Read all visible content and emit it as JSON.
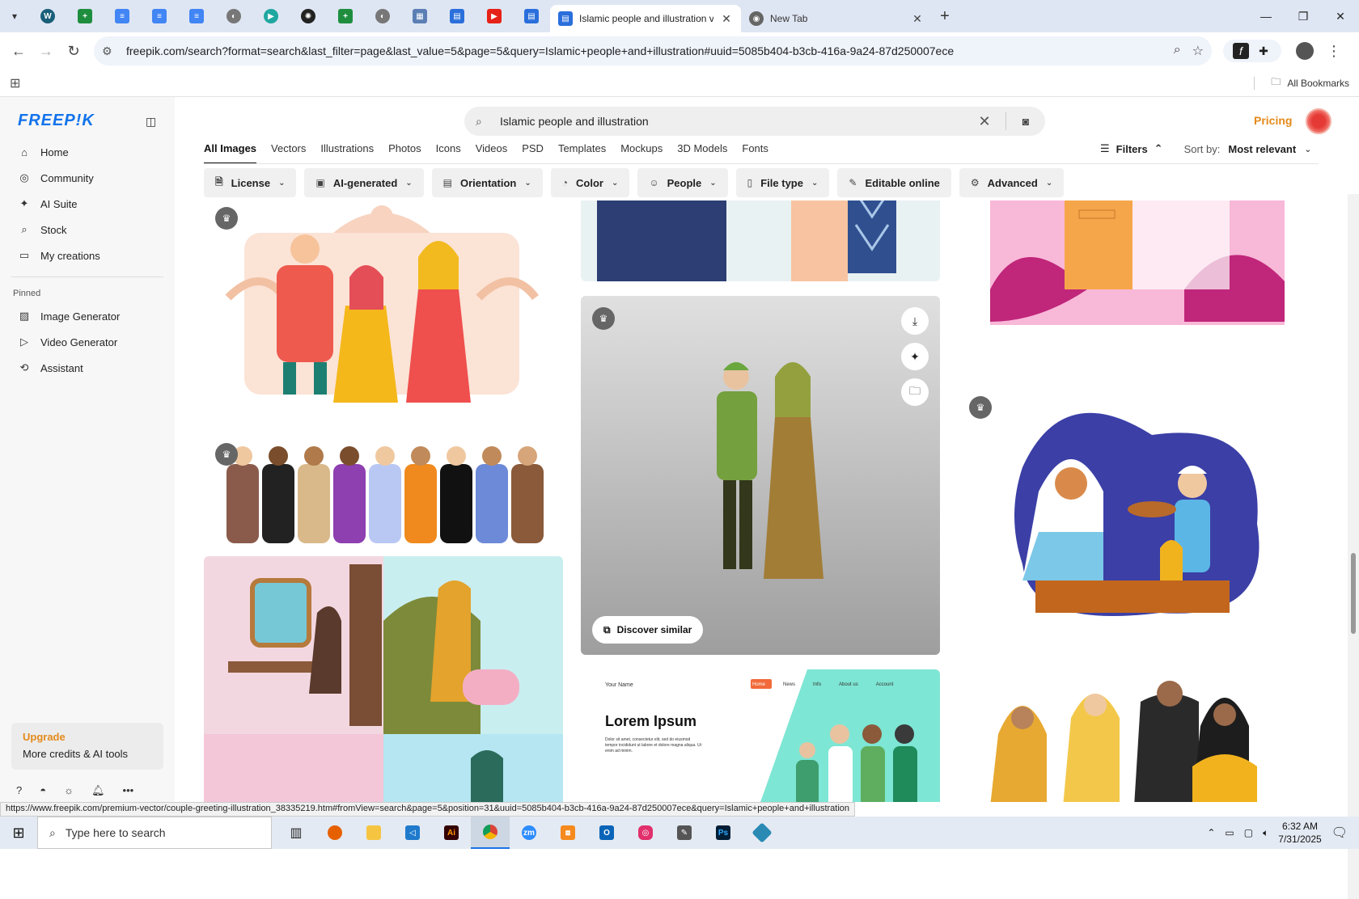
{
  "browser": {
    "tabs": [
      {
        "title": "Islamic people and illustration v",
        "active": true
      },
      {
        "title": "New Tab",
        "active": false
      }
    ],
    "url": "freepik.com/search?format=search&last_filter=page&last_value=5&page=5&query=Islamic+people+and+illustration#uuid=5085b404-b3cb-416a-9a24-87d250007ece",
    "all_bookmarks": "All Bookmarks",
    "status_url": "https://www.freepik.com/premium-vector/couple-greeting-illustration_38335219.htm#fromView=search&page=5&position=31&uuid=5085b404-b3cb-416a-9a24-87d250007ece&query=Islamic+people+and+illustration"
  },
  "sidebar": {
    "logo": "FREEP!K",
    "nav": [
      {
        "label": "Home",
        "icon": "home-icon"
      },
      {
        "label": "Community",
        "icon": "globe-icon"
      },
      {
        "label": "AI Suite",
        "icon": "sparkle-icon"
      },
      {
        "label": "Stock",
        "icon": "search-icon"
      },
      {
        "label": "My creations",
        "icon": "folder-icon"
      }
    ],
    "pinned_label": "Pinned",
    "pinned": [
      {
        "label": "Image Generator",
        "icon": "image-icon"
      },
      {
        "label": "Video Generator",
        "icon": "video-icon"
      },
      {
        "label": "Assistant",
        "icon": "chat-icon"
      }
    ],
    "upgrade_title": "Upgrade",
    "upgrade_sub": "More credits & AI tools"
  },
  "header": {
    "search_value": "Islamic people and illustration",
    "pricing": "Pricing"
  },
  "type_tabs": [
    "All Images",
    "Vectors",
    "Illustrations",
    "Photos",
    "Icons",
    "Videos",
    "PSD",
    "Templates",
    "Mockups",
    "3D Models",
    "Fonts"
  ],
  "filters": {
    "filters_label": "Filters",
    "sort_label": "Sort by:",
    "sort_value": "Most relevant"
  },
  "chips": [
    {
      "label": "License",
      "icon": "license-icon"
    },
    {
      "label": "AI-generated",
      "icon": "ai-icon"
    },
    {
      "label": "Orientation",
      "icon": "orientation-icon"
    },
    {
      "label": "Color",
      "icon": "palette-icon"
    },
    {
      "label": "People",
      "icon": "people-icon"
    },
    {
      "label": "File type",
      "icon": "file-icon"
    },
    {
      "label": "Editable online",
      "icon": "pen-icon",
      "no_chevron": true
    },
    {
      "label": "Advanced",
      "icon": "gear-icon"
    }
  ],
  "card_hover": {
    "discover_similar": "Discover similar"
  },
  "landing_mock": {
    "your_name": "Your Name",
    "nav": [
      "Home",
      "News",
      "Info",
      "About us",
      "Account"
    ],
    "headline": "Lorem Ipsum",
    "body": "Dolor sit amet, consectetur elit, sed do eiusmod tempor incididunt ut labore et dolore magna aliqua. Ut enim ad minim."
  },
  "taskbar": {
    "search_placeholder": "Type here to search",
    "time": "6:32 AM",
    "date": "7/31/2025"
  }
}
